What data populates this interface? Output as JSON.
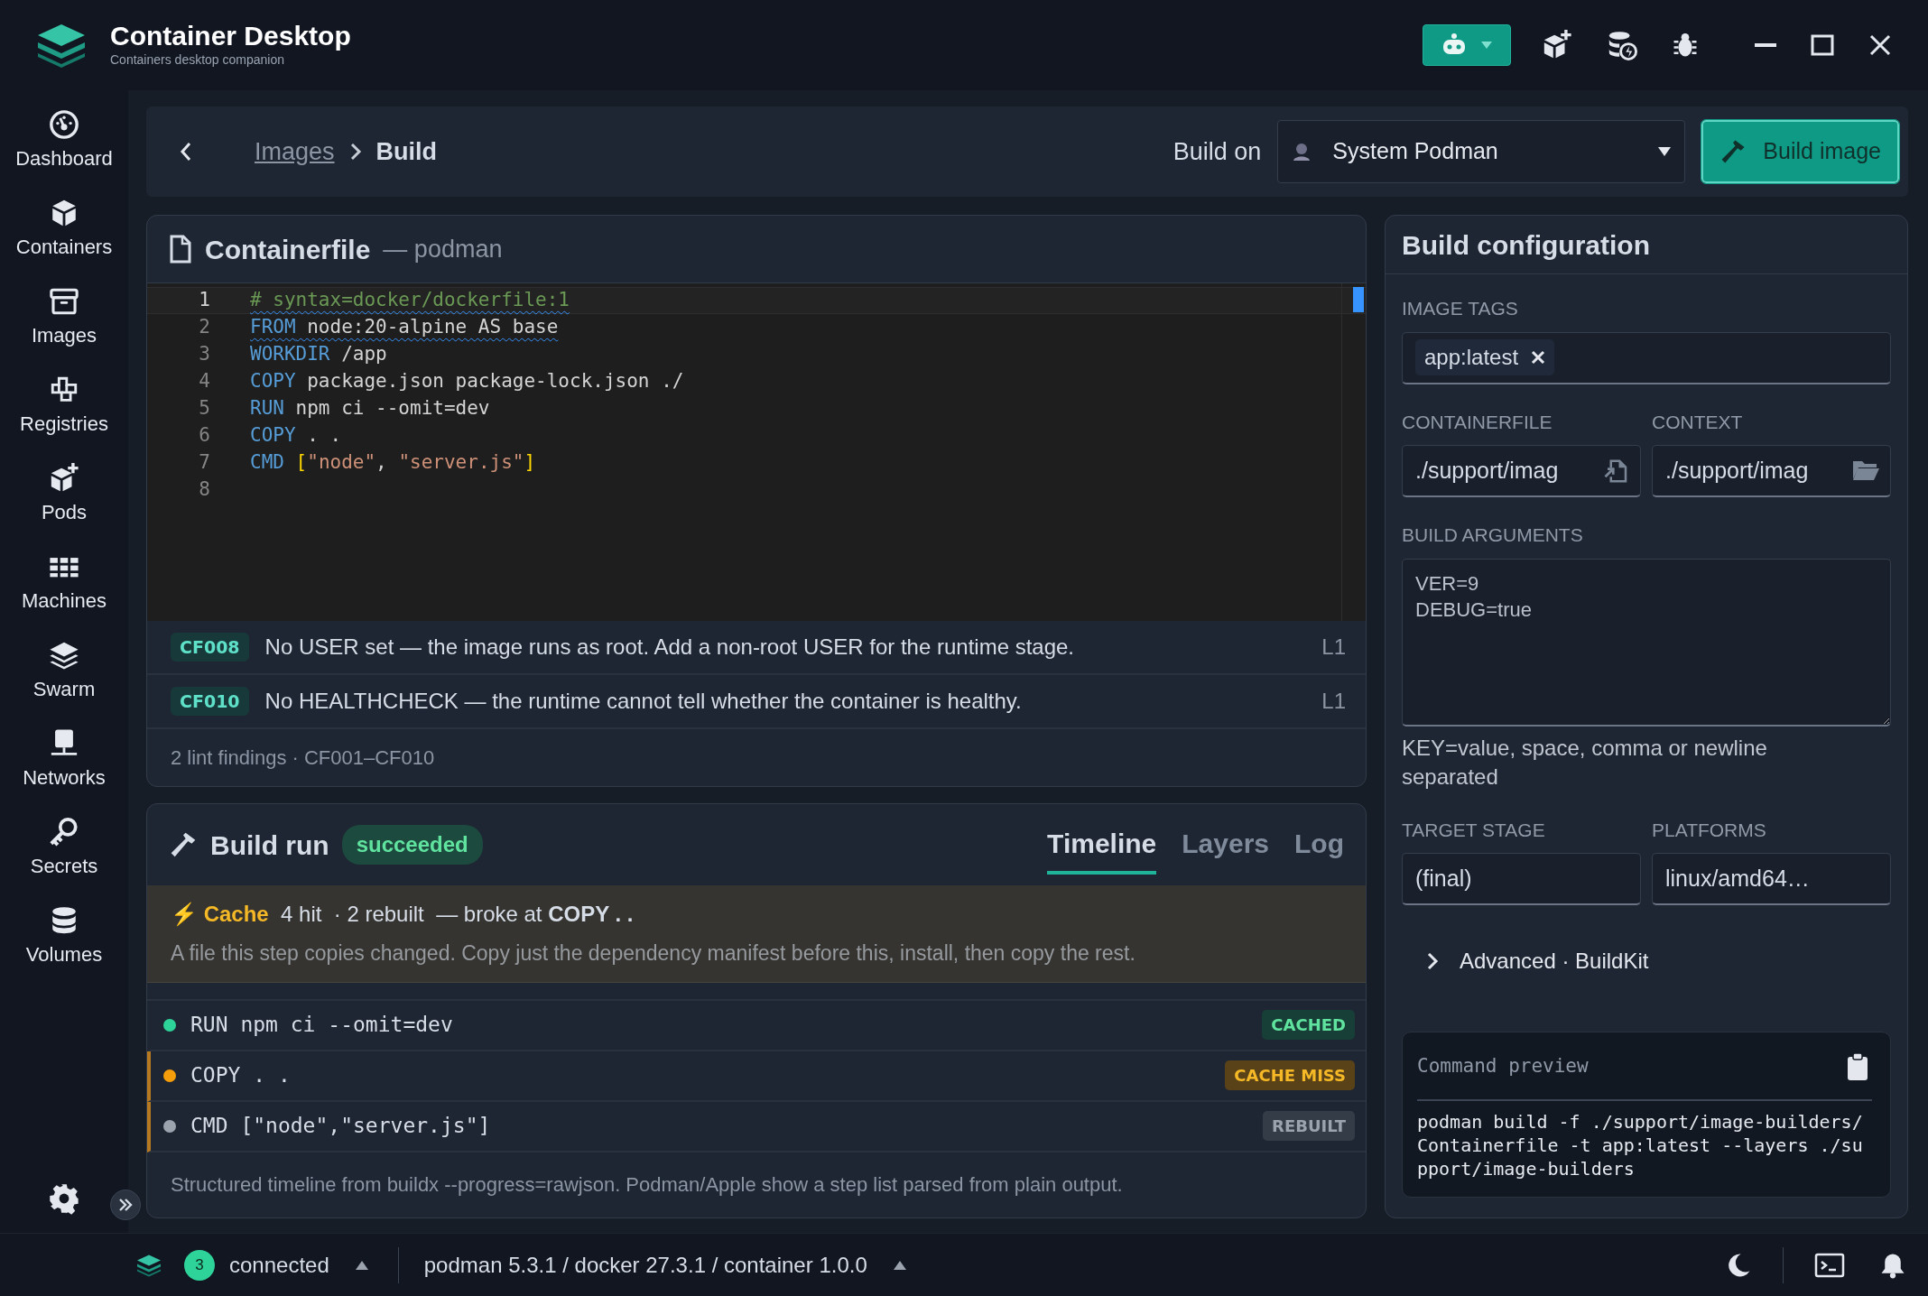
{
  "app": {
    "title": "Container Desktop",
    "subtitle": "Containers desktop companion"
  },
  "sidebar": {
    "items": [
      {
        "label": "Dashboard",
        "kind": "dashboard"
      },
      {
        "label": "Containers",
        "kind": "cube"
      },
      {
        "label": "Images",
        "kind": "box"
      },
      {
        "label": "Registries",
        "kind": "registry"
      },
      {
        "label": "Pods",
        "kind": "pod"
      },
      {
        "label": "Machines",
        "kind": "grid"
      },
      {
        "label": "Swarm",
        "kind": "layers"
      },
      {
        "label": "Networks",
        "kind": "network"
      },
      {
        "label": "Secrets",
        "kind": "key"
      },
      {
        "label": "Volumes",
        "kind": "database"
      }
    ]
  },
  "breadcrumb": [
    {
      "label": "Images",
      "current": false
    },
    {
      "label": "Build",
      "current": true
    }
  ],
  "build_on": {
    "label": "Build on",
    "engine": "System Podman"
  },
  "build_button": "Build image",
  "containerfile": {
    "title": "Containerfile",
    "subtitle": "— podman",
    "lines": [
      {
        "number": "1",
        "active": true,
        "squiggle": true,
        "tokens": [
          {
            "kind": "comment",
            "text": "# syntax=docker/dockerfile:1"
          }
        ]
      },
      {
        "number": "2",
        "active": false,
        "squiggle": true,
        "tokens": [
          {
            "kind": "keyword",
            "text": "FROM"
          },
          {
            "kind": "plain",
            "text": " node:20-alpine AS base"
          }
        ]
      },
      {
        "number": "3",
        "active": false,
        "squiggle": false,
        "tokens": [
          {
            "kind": "keyword",
            "text": "WORKDIR"
          },
          {
            "kind": "plain",
            "text": " /app"
          }
        ]
      },
      {
        "number": "4",
        "active": false,
        "squiggle": false,
        "tokens": [
          {
            "kind": "keyword",
            "text": "COPY"
          },
          {
            "kind": "plain",
            "text": " package.json package-lock.json ./"
          }
        ]
      },
      {
        "number": "5",
        "active": false,
        "squiggle": false,
        "tokens": [
          {
            "kind": "keyword",
            "text": "RUN"
          },
          {
            "kind": "plain",
            "text": " npm ci --omit=dev"
          }
        ]
      },
      {
        "number": "6",
        "active": false,
        "squiggle": false,
        "tokens": [
          {
            "kind": "keyword",
            "text": "COPY"
          },
          {
            "kind": "plain",
            "text": " . ."
          }
        ]
      },
      {
        "number": "7",
        "active": false,
        "squiggle": false,
        "tokens": [
          {
            "kind": "keyword",
            "text": "CMD"
          },
          {
            "kind": "bracket",
            "text": " ["
          },
          {
            "kind": "string",
            "text": "\"node\""
          },
          {
            "kind": "plain",
            "text": ", "
          },
          {
            "kind": "string",
            "text": "\"server.js\""
          },
          {
            "kind": "bracket",
            "text": "]"
          }
        ]
      },
      {
        "number": "8",
        "active": false
      }
    ]
  },
  "lint": {
    "findings": [
      {
        "code": "CF008",
        "message": "No USER set — the image runs as root. Add a non-root USER for the runtime stage.",
        "line": "L1"
      },
      {
        "code": "CF010",
        "message": "No HEALTHCHECK — the runtime cannot tell whether the container is healthy.",
        "line": "L1"
      }
    ],
    "summary": "2 lint findings · CF001–CF010"
  },
  "build_run": {
    "title": "Build run",
    "status": "succeeded",
    "tabs": [
      {
        "label": "Timeline",
        "selected": true
      },
      {
        "label": "Layers",
        "selected": false
      },
      {
        "label": "Log",
        "selected": false
      }
    ],
    "cache": {
      "glyph": "⚡",
      "label": "Cache",
      "hit": "4 hit",
      "rebuilt": "· 2 rebuilt",
      "broke": "— broke at **COPY . .**",
      "hint": "A file this step copies changed. Copy just the dependency manifest before this, install, then copy the rest."
    },
    "steps": [
      {
        "command": "RUN npm ci --omit=dev",
        "kind": "cached",
        "badge": "CACHED"
      },
      {
        "command": "COPY . .",
        "kind": "miss",
        "badge": "CACHE MISS"
      },
      {
        "command": "CMD [\"node\",\"server.js\"]",
        "kind": "rebuilt",
        "badge": "REBUILT"
      }
    ],
    "footnote": "Structured timeline from buildx --progress=rawjson. Podman/Apple show a step list parsed from plain output."
  },
  "config": {
    "title": "Build configuration",
    "tags": {
      "label": "IMAGE TAGS",
      "values": [
        "app:latest"
      ]
    },
    "containerfile": {
      "label": "CONTAINERFILE",
      "value": "./support/imag"
    },
    "context": {
      "label": "CONTEXT",
      "value": "./support/imag"
    },
    "build_args": {
      "label": "BUILD ARGUMENTS",
      "value": "VER=9\nDEBUG=true",
      "help": "KEY=value, space, comma or newline separated"
    },
    "target_stage": {
      "label": "TARGET STAGE",
      "value": "(final)"
    },
    "platforms": {
      "label": "PLATFORMS",
      "value": "linux/amd64…"
    },
    "advanced": {
      "label": "Advanced · BuildKit",
      "expanded": false
    },
    "preview": {
      "title": "Command preview",
      "command": "podman build -f ./support/image-builders/Containerfile -t app:latest --layers ./support/image-builders"
    }
  },
  "status_bar": {
    "count": "3",
    "connection": "connected",
    "versions": "podman 5.3.1 / docker 27.3.1 / container 1.0.0"
  }
}
